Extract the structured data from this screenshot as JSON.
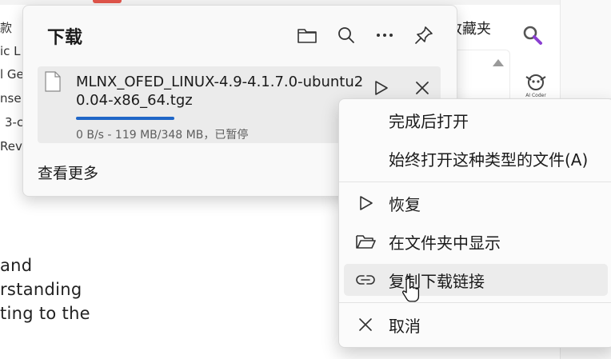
{
  "background": {
    "left_fragments": [
      "款",
      "ic L",
      "l Ge",
      "nse",
      "3-c",
      "Revi"
    ],
    "paragraph_lines": [
      "and",
      "rstanding",
      "ting to the"
    ],
    "favorites_label": "收藏夹",
    "logo_text": "AI Coder"
  },
  "downloads": {
    "title": "下载",
    "header_icons": [
      "folder-icon",
      "search-icon",
      "more-icon",
      "pin-icon"
    ],
    "item": {
      "filename": "MLNX_OFED_LINUX-4.9-4.1.7.0-ubuntu20.04-x86_64.tgz",
      "status": "0 B/s - 119 MB/348 MB，已暂停",
      "progress_fraction": 0.342,
      "actions": [
        "resume-icon",
        "cancel-icon"
      ]
    },
    "see_more": "查看更多"
  },
  "context_menu": {
    "items": [
      {
        "label": "完成后打开",
        "icon": ""
      },
      {
        "label": "始终打开这种类型的文件(A)",
        "icon": ""
      },
      {
        "label": "恢复",
        "icon": "play-icon"
      },
      {
        "label": "在文件夹中显示",
        "icon": "folder-open-icon"
      },
      {
        "label": "复制下载链接",
        "icon": "link-icon"
      },
      {
        "label": "取消",
        "icon": "close-icon"
      }
    ],
    "hovered_index": 4
  },
  "colors": {
    "accent": "#1f66c7",
    "flyout_bg": "#f9f9f9",
    "item_bg": "#ebebeb",
    "hover_bg": "#ececec"
  }
}
